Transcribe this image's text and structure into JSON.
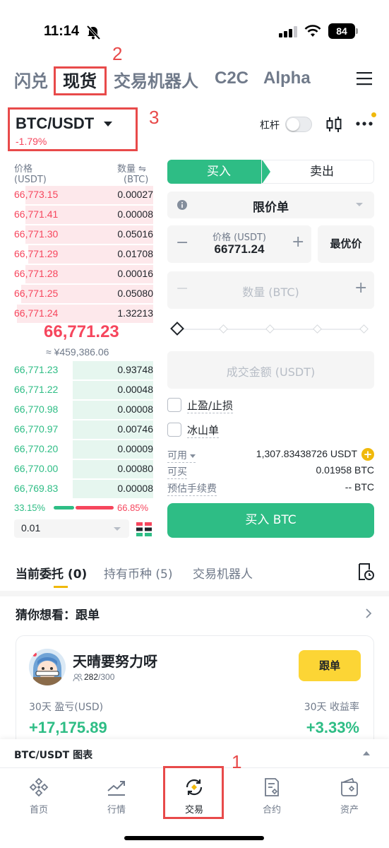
{
  "status_bar": {
    "time": "11:14",
    "battery": "84"
  },
  "top_nav": {
    "tabs": [
      {
        "label": "闪兑",
        "active": false
      },
      {
        "label": "现货",
        "active": true
      },
      {
        "label": "交易机器人",
        "active": false
      },
      {
        "label": "C2C",
        "active": false
      },
      {
        "label": "Alpha",
        "active": false
      }
    ]
  },
  "annotations": [
    "1",
    "2",
    "3"
  ],
  "pair": {
    "name": "BTC/USDT",
    "change": "-1.79%",
    "leverage_label": "杠杆"
  },
  "order_book": {
    "price_header": "价格",
    "price_unit": "(USDT)",
    "qty_header": "数量 ⇋",
    "qty_unit": "(BTC)",
    "asks": [
      {
        "price": "66,773.15",
        "qty": "0.00027",
        "depth": 0.92
      },
      {
        "price": "66,771.41",
        "qty": "0.00008",
        "depth": 0.92
      },
      {
        "price": "66,771.30",
        "qty": "0.05016",
        "depth": 0.92
      },
      {
        "price": "66,771.29",
        "qty": "0.01708",
        "depth": 0.9
      },
      {
        "price": "66,771.28",
        "qty": "0.00016",
        "depth": 0.92
      },
      {
        "price": "66,771.25",
        "qty": "0.05080",
        "depth": 0.95
      },
      {
        "price": "66,771.24",
        "qty": "1.32213",
        "depth": 0.98
      }
    ],
    "mid_price": "66,771.23",
    "mid_cny": "≈ ¥459,386.06",
    "bids": [
      {
        "price": "66,771.23",
        "qty": "0.93748",
        "depth": 0.58
      },
      {
        "price": "66,771.22",
        "qty": "0.00048",
        "depth": 0.58
      },
      {
        "price": "66,770.98",
        "qty": "0.00008",
        "depth": 0.58
      },
      {
        "price": "66,770.97",
        "qty": "0.00746",
        "depth": 0.58
      },
      {
        "price": "66,770.20",
        "qty": "0.00009",
        "depth": 0.58
      },
      {
        "price": "66,770.00",
        "qty": "0.00080",
        "depth": 0.58
      },
      {
        "price": "66,769.83",
        "qty": "0.00008",
        "depth": 0.58
      }
    ],
    "buy_ratio": "33.15%",
    "sell_ratio": "66.85%",
    "precision": "0.01"
  },
  "order_form": {
    "buy_tab": "买入",
    "sell_tab": "卖出",
    "order_type": "限价单",
    "price_label": "价格 (USDT)",
    "price_value": "66771.24",
    "best_price": "最优价",
    "qty_placeholder": "数量 (BTC)",
    "amount_placeholder": "成交金额 (USDT)",
    "tp_sl": "止盈/止损",
    "iceberg": "冰山单",
    "available_label": "可用",
    "available_value": "1,307.83438726 USDT",
    "can_buy_label": "可买",
    "can_buy_value": "0.01958 BTC",
    "fee_label": "预估手续费",
    "fee_value": "-- BTC",
    "submit": "买入 BTC"
  },
  "orders_tabs": [
    {
      "label": "当前委托 (0)",
      "active": true
    },
    {
      "label": "持有币种 (5)",
      "active": false
    },
    {
      "label": "交易机器人",
      "active": false
    }
  ],
  "guess": {
    "title": "猜你想看：跟单",
    "trader": {
      "name": "天晴要努力呀",
      "followers": "282",
      "followers_max": "/300",
      "follow_button": "跟单",
      "pnl_label": "30天 盈亏(USD)",
      "pnl_value": "+17,175.89",
      "roi_label": "30天 收益率",
      "roi_value": "+3.33%"
    }
  },
  "chart_bar": {
    "label": "BTC/USDT 图表"
  },
  "bottom_nav": [
    {
      "label": "首页",
      "icon": "home-icon"
    },
    {
      "label": "行情",
      "icon": "markets-icon"
    },
    {
      "label": "交易",
      "icon": "trade-icon"
    },
    {
      "label": "合约",
      "icon": "futures-icon"
    },
    {
      "label": "资产",
      "icon": "wallet-icon"
    }
  ],
  "colors": {
    "buy": "#2ebd85",
    "sell": "#f6465d",
    "accent": "#f0b90b",
    "annotation": "#e84a4a"
  }
}
